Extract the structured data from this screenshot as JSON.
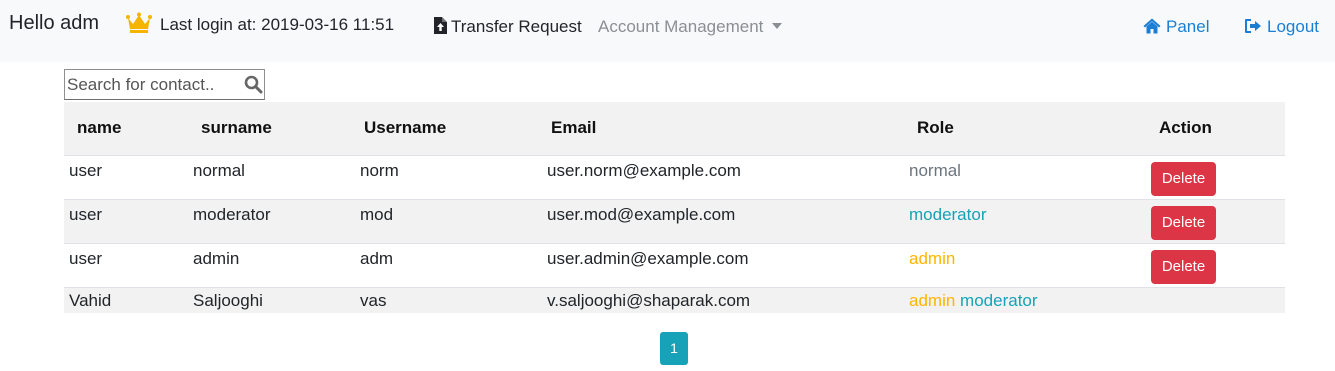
{
  "header": {
    "greeting": "Hello adm",
    "last_login": "Last login at: 2019-03-16 11:51",
    "nav": {
      "transfer_request": "Transfer Request",
      "account_management": "Account Management",
      "panel": "Panel",
      "logout": "Logout"
    },
    "icons": {
      "crown": "crown-icon",
      "transfer": "file-upload-icon",
      "panel": "home-icon",
      "logout": "sign-out-icon"
    }
  },
  "search": {
    "placeholder": "Search for contact..",
    "value": ""
  },
  "table": {
    "columns": [
      "name",
      "surname",
      "Username",
      "Email",
      "Role",
      "Action"
    ],
    "rows": [
      {
        "name": "user",
        "surname": "normal",
        "username": "norm",
        "email": "user.norm@example.com",
        "roles": [
          "normal"
        ],
        "action": "Delete"
      },
      {
        "name": "user",
        "surname": "moderator",
        "username": "mod",
        "email": "user.mod@example.com",
        "roles": [
          "moderator"
        ],
        "action": "Delete"
      },
      {
        "name": "user",
        "surname": "admin",
        "username": "adm",
        "email": "user.admin@example.com",
        "roles": [
          "admin"
        ],
        "action": "Delete"
      },
      {
        "name": "Vahid",
        "surname": "Saljooghi",
        "username": "vas",
        "email": "v.saljooghi@shaparak.com",
        "roles": [
          "admin",
          "moderator"
        ],
        "action": ""
      }
    ]
  },
  "pagination": {
    "current_page": "1"
  },
  "colors": {
    "navbar_bg": "#f8f9fa",
    "link_blue": "#1a7fd4",
    "danger": "#dc3545",
    "info": "#17a2b8",
    "warning": "#ffb400",
    "muted": "#6c757d"
  }
}
